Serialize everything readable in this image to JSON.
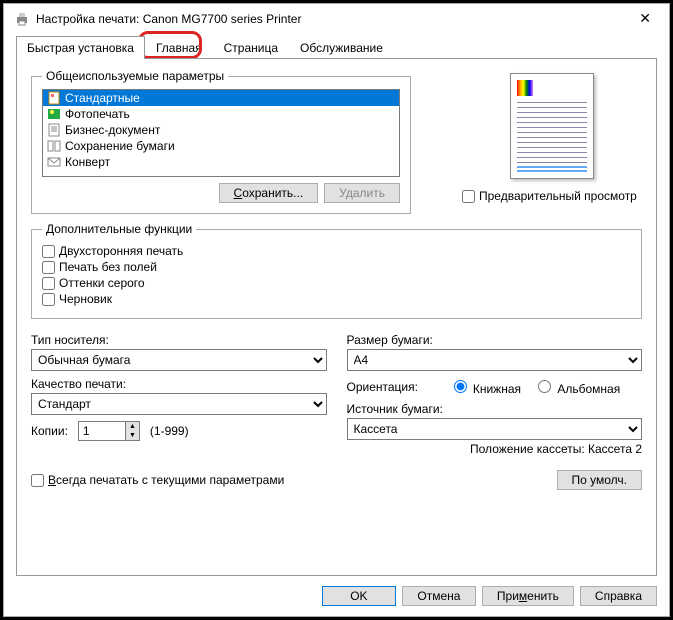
{
  "title": "Настройка печати: Canon MG7700 series Printer",
  "tabs": {
    "quick": "Быстрая установка",
    "main": "Главная",
    "page": "Страница",
    "service": "Обслуживание"
  },
  "groups": {
    "common": "Общеиспользуемые параметры",
    "extra": "Дополнительные функции"
  },
  "profiles": [
    "Стандартные",
    "Фотопечать",
    "Бизнес-документ",
    "Сохранение бумаги",
    "Конверт"
  ],
  "buttons": {
    "save": "Сохранить...",
    "delete": "Удалить",
    "default": "По умолч.",
    "ok": "OK",
    "cancel": "Отмена",
    "apply": "Применить",
    "help": "Справка"
  },
  "preview_label": "Предварительный просмотр",
  "extra": {
    "duplex": "Двухсторонняя печать",
    "borderless": "Печать без полей",
    "grayscale": "Оттенки серого",
    "draft": "Черновик"
  },
  "labels": {
    "media": "Тип носителя:",
    "quality": "Качество печати:",
    "size": "Размер бумаги:",
    "orient": "Ориентация:",
    "source": "Источник бумаги:",
    "cassette": "Положение кассеты: Кассета 2",
    "copies": "Копии:",
    "copies_range": "(1-999)",
    "always": "Всегда печатать с текущими параметрами"
  },
  "values": {
    "media": "Обычная бумага",
    "quality": "Стандарт",
    "size": "A4",
    "source": "Кассета",
    "copies": "1"
  },
  "orient": {
    "portrait": "Книжная",
    "landscape": "Альбомная"
  }
}
